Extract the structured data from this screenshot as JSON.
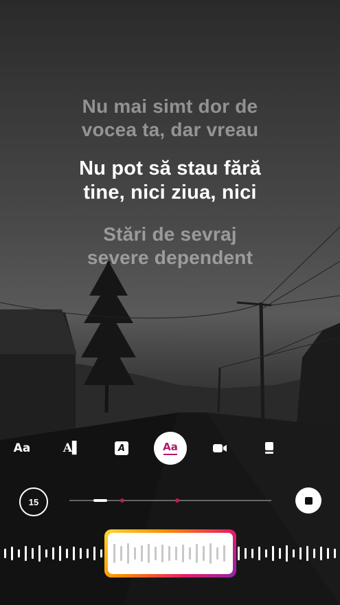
{
  "lyrics": {
    "previous": [
      "Nu mai simt dor de",
      "vocea ta, dar vreau"
    ],
    "current": [
      "Nu pot să stau fără",
      "tine, nici ziua, nici"
    ],
    "next": [
      "Stări de sevraj",
      "severe dependent"
    ]
  },
  "toolbar": {
    "tools": [
      {
        "name": "typewriter-style",
        "icon": "text-size-icon",
        "glyph": "Aa"
      },
      {
        "name": "text-cursor-style",
        "icon": "text-cursor-icon",
        "glyph": "A▌"
      },
      {
        "name": "boxed-italic-style",
        "icon": "boxed-a-icon",
        "glyph": "A"
      },
      {
        "name": "karaoke-style",
        "icon": "karaoke-text-icon",
        "glyph": "Aa",
        "selected": true
      },
      {
        "name": "video-style",
        "icon": "video-camera-icon"
      },
      {
        "name": "sticker-style",
        "icon": "display-card-icon"
      }
    ]
  },
  "playback": {
    "duration_label": "15",
    "progress_fraction": 0.14,
    "marker_positions": [
      0.26,
      0.535
    ]
  },
  "colors": {
    "accent": "#c2185b",
    "selector_gradient": [
      "#fdd835",
      "#fb8c00",
      "#e91e63",
      "#8e24aa"
    ]
  }
}
